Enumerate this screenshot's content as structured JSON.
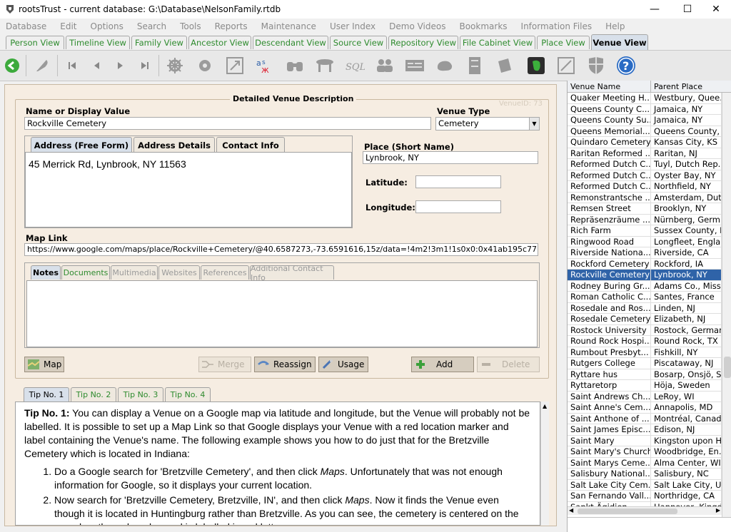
{
  "window": {
    "title": "rootsTrust - current database: G:\\Database\\NelsonFamily.rtdb",
    "minimize": "—",
    "maximize": "☐",
    "close": "✕"
  },
  "menu": [
    "Database",
    "Edit",
    "Options",
    "Search",
    "Tools",
    "Reports",
    "Maintenance",
    "User Index",
    "Demo Videos",
    "Bookmarks",
    "Information Files",
    "Help"
  ],
  "view_tabs": [
    "Person View",
    "Timeline View",
    "Family View",
    "Ancestor View",
    "Descendant View",
    "Source View",
    "Repository View",
    "File Cabinet View",
    "Place View",
    "Venue View"
  ],
  "active_view": "Venue View",
  "form": {
    "group_title": "Detailed Venue Description",
    "venue_id": "VenueID: 73",
    "name_label": "Name or Display Value",
    "name_value": "Rockville Cemetery",
    "type_label": "Venue Type",
    "type_value": "Cemetery",
    "address_tabs": [
      "Address (Free Form)",
      "Address Details",
      "Contact Info"
    ],
    "address_text": "45 Merrick Rd, Lynbrook, NY 11563",
    "place_label": "Place (Short Name)",
    "place_value": "Lynbrook, NY",
    "latitude_label": "Latitude:",
    "latitude_value": "",
    "longitude_label": "Longitude:",
    "longitude_value": "",
    "maplink_label": "Map Link",
    "maplink_value": "https://www.google.com/maps/place/Rockville+Cemetery/@40.6587273,-73.6591616,15z/data=!4m2!3m1!1s0x0:0x41ab195c77b57335",
    "notes_tabs": [
      "Notes",
      "Documents",
      "Multimedia",
      "Websites",
      "References",
      "Additional Contact Info"
    ],
    "notes_text": ""
  },
  "buttons": {
    "map": "Map",
    "merge": "Merge",
    "reassign": "Reassign",
    "usage": "Usage",
    "add": "Add",
    "delete": "Delete"
  },
  "tips": {
    "tabs": [
      "Tip No. 1",
      "Tip No. 2",
      "Tip No. 3",
      "Tip No. 4"
    ],
    "heading": "Tip No. 1:",
    "intro": " You can display a Venue on a Google map via latitude and longitude, but the Venue will probably not be labelled. It is possible to set up a Map Link so that Google displays your Venue with a red location marker and label containing the Venue's name. The following example shows you how to do just that for the Bretzville Cemetery which is located in Indiana:",
    "step1_a": "Do a Google search for 'Bretzville Cemetery', and then click ",
    "step1_em": "Maps",
    "step1_b": ". Unfortunately that was not enough information for Google, so it displays your current location.",
    "step2_a": "Now search for 'Bretzville Cemetery, Bretzville, IN', and then click ",
    "step2_em": "Maps",
    "step2_b": ". Now it finds the Venue even though it is located in Huntingburg rather than Bretzville. As you can see, the cemetery is centered on the map, has the red marker and is labelled in red letters."
  },
  "venue_list": {
    "col_name": "Venue Name",
    "col_place": "Parent Place",
    "selected": "Rockville Cemetery",
    "rows": [
      [
        "Quaker Meeting H...",
        "Westbury, Quee..."
      ],
      [
        "Queens County C...",
        "Jamaica, NY"
      ],
      [
        "Queens County Su...",
        "Jamaica, NY"
      ],
      [
        "Queens Memorial...",
        "Queens County, ..."
      ],
      [
        "Quindaro Cemetery",
        "Kansas City, KS"
      ],
      [
        "Raritan Reformed ...",
        "Raritan, NJ"
      ],
      [
        "Reformed Dutch C...",
        "Tuyl, Dutch Rep..."
      ],
      [
        "Reformed Dutch C...",
        "Oyster Bay, NY"
      ],
      [
        "Reformed Dutch C...",
        "Northfield, NY"
      ],
      [
        "Remonstrantsche ...",
        "Amsterdam, Dut..."
      ],
      [
        "Remsen Street",
        "Brooklyn, NY"
      ],
      [
        "Repräsenzräume ...",
        "Nürnberg, Germ..."
      ],
      [
        "Rich Farm",
        "Sussex County, DE"
      ],
      [
        "Ringwood Road",
        "Longfleet, England"
      ],
      [
        "Riverside Nationa...",
        "Riverside, CA"
      ],
      [
        "Rockford Cemetery",
        "Rockford, IA"
      ],
      [
        "Rockville Cemetery",
        "Lynbrook, NY"
      ],
      [
        "Rodney Buring Gr...",
        "Adams Co., Miss..."
      ],
      [
        "Roman Catholic C...",
        "Santes, France"
      ],
      [
        "Rosedale and Ros...",
        "Linden, NJ"
      ],
      [
        "Rosedale Cemetery",
        "Elizabeth, NJ"
      ],
      [
        "Rostock University",
        "Rostock, Germany"
      ],
      [
        "Round Rock Hospi...",
        "Round Rock, TX"
      ],
      [
        "Rumbout Presbyt...",
        "Fishkill, NY"
      ],
      [
        "Rutgers College",
        "Piscataway, NJ"
      ],
      [
        "Ryttare hus",
        "Bosarp, Onsjö, S..."
      ],
      [
        "Ryttaretorp",
        "Höja, Sweden"
      ],
      [
        "Saint Andrews Ch...",
        "LeRoy, WI"
      ],
      [
        "Saint Anne's Cem...",
        "Annapolis, MD"
      ],
      [
        "Saint Anthone of ...",
        "Montréal, Canada"
      ],
      [
        "Saint James Episc...",
        "Edison, NJ"
      ],
      [
        "Saint Mary",
        "Kingston upon H..."
      ],
      [
        "Saint Mary's Church",
        "Woodbridge, En..."
      ],
      [
        "Saint Marys Ceme...",
        "Alma Center, WI"
      ],
      [
        "Salisbury National...",
        "Salisbury, NC"
      ],
      [
        "Salt Lake City Cem...",
        "Salt Lake City, UT"
      ],
      [
        "San Fernando Vall...",
        "Northridge, CA"
      ],
      [
        "Sankt Ägidien",
        "Hannover, Kingd..."
      ]
    ]
  }
}
